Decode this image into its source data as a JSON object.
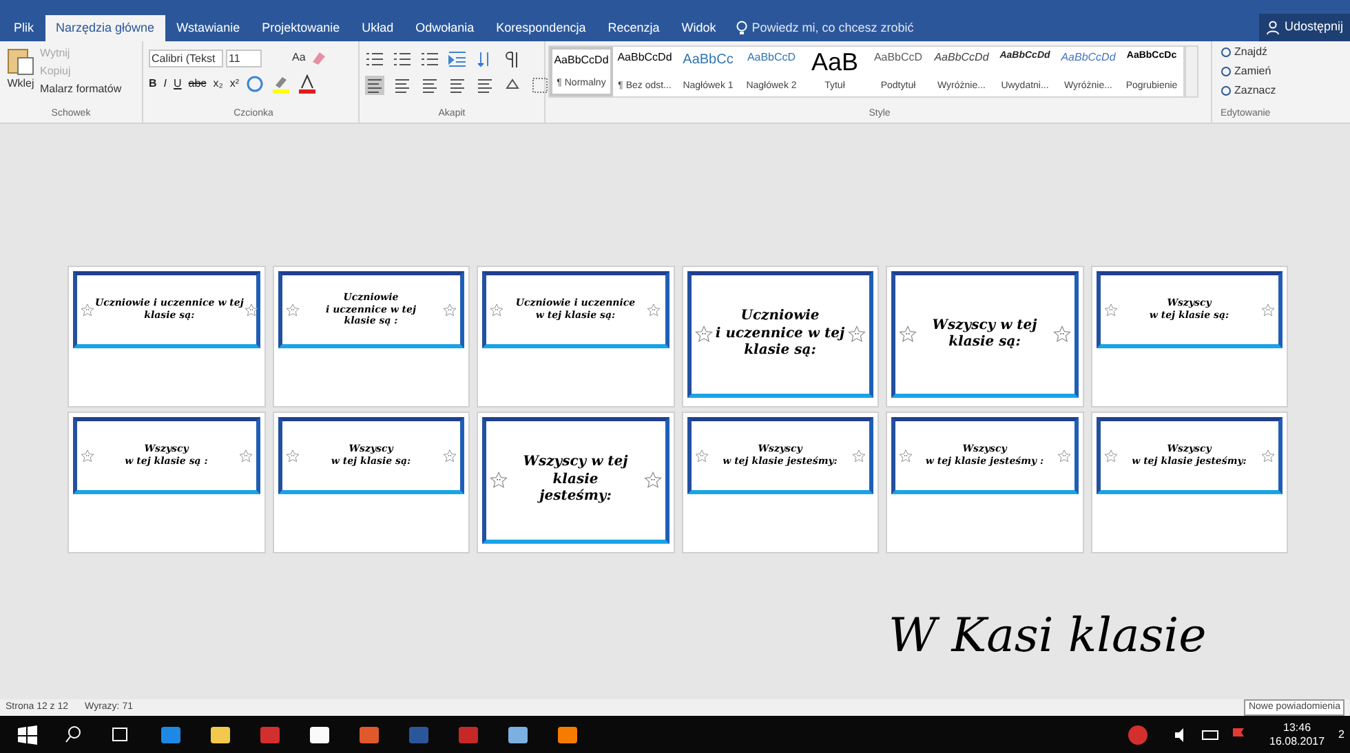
{
  "ribbon_tabs": [
    {
      "label": "Plik",
      "selected": false
    },
    {
      "label": "Narzędzia główne",
      "selected": true
    },
    {
      "label": "Wstawianie",
      "selected": false
    },
    {
      "label": "Projektowanie",
      "selected": false
    },
    {
      "label": "Układ",
      "selected": false
    },
    {
      "label": "Odwołania",
      "selected": false
    },
    {
      "label": "Korespondencja",
      "selected": false
    },
    {
      "label": "Recenzja",
      "selected": false
    },
    {
      "label": "Widok",
      "selected": false
    }
  ],
  "tell_me": {
    "placeholder": "Powiedz mi, co chcesz zrobić"
  },
  "share_button": "Udostępnij",
  "clipboard": {
    "paste": "Wklej",
    "items": [
      {
        "label": "Wytnij",
        "disabled": true
      },
      {
        "label": "Kopiuj",
        "disabled": true
      },
      {
        "label": "Malarz formatów",
        "disabled": false
      }
    ],
    "group": "Schowek"
  },
  "font": {
    "name": "Calibri (Tekst",
    "size": "11",
    "case": "Aa",
    "format_buttons": [
      "B",
      "I",
      "U",
      "abc",
      "x₂",
      "x²"
    ],
    "group": "Czcionka"
  },
  "paragraph": {
    "group": "Akapit"
  },
  "styles": {
    "group": "Style",
    "items": [
      {
        "preview": "AaBbCcDd",
        "name": "¶ Normalny",
        "kind": "normal",
        "selected": true
      },
      {
        "preview": "AaBbCcDd",
        "name": "¶ Bez odst...",
        "kind": "normal",
        "selected": false
      },
      {
        "preview": "AaBbCc",
        "name": "Nagłówek 1",
        "kind": "heading1",
        "selected": false
      },
      {
        "preview": "AaBbCcD",
        "name": "Nagłówek 2",
        "kind": "heading2",
        "selected": false
      },
      {
        "preview": "AaB",
        "name": "Tytuł",
        "kind": "title",
        "selected": false
      },
      {
        "preview": "AaBbCcD",
        "name": "Podtytuł",
        "kind": "subtitle",
        "selected": false
      },
      {
        "preview": "AaBbCcDd",
        "name": "Wyróżnie...",
        "kind": "emphasis",
        "selected": false
      },
      {
        "preview": "AaBbCcDd",
        "name": "Uwydatni...",
        "kind": "intense",
        "selected": false
      },
      {
        "preview": "AaBbCcDd",
        "name": "Wyróżnie...",
        "kind": "blue",
        "selected": false
      },
      {
        "preview": "AaBbCcDc",
        "name": "Pogrubienie",
        "kind": "strong",
        "selected": false
      }
    ]
  },
  "editing": {
    "group": "Edytowanie",
    "items": [
      "Znajdź",
      "Zamień",
      "Zaznacz"
    ]
  },
  "pages": [
    {
      "lines": [
        "Uczniowie i uczennice w tej",
        "klasie są:"
      ],
      "kind": "small"
    },
    {
      "lines": [
        "Uczniowie",
        "i uczennice w tej",
        "klasie są :"
      ],
      "kind": "small"
    },
    {
      "lines": [
        "Uczniowie i uczennice",
        "w tej klasie są:"
      ],
      "kind": "small"
    },
    {
      "lines": [
        "Uczniowie",
        "i uczennice w tej",
        "klasie są:"
      ],
      "kind": "large"
    },
    {
      "lines": [
        "Wszyscy w tej",
        "klasie są:"
      ],
      "kind": "large"
    },
    {
      "lines": [
        "Wszyscy",
        "w tej klasie są:"
      ],
      "kind": "small"
    },
    {
      "lines": [
        "Wszyscy",
        "w tej klasie są :"
      ],
      "kind": "small"
    },
    {
      "lines": [
        "Wszyscy",
        "w tej klasie są:"
      ],
      "kind": "small"
    },
    {
      "lines": [
        "Wszyscy w tej",
        "klasie",
        "jesteśmy:"
      ],
      "kind": "large"
    },
    {
      "lines": [
        "Wszyscy",
        "w tej klasie jesteśmy:"
      ],
      "kind": "small"
    },
    {
      "lines": [
        "Wszyscy",
        "w tej klasie jesteśmy :"
      ],
      "kind": "small"
    },
    {
      "lines": [
        "Wszyscy",
        "w tej klasie jesteśmy:"
      ],
      "kind": "small"
    }
  ],
  "handwriting": "W Kasi klasie",
  "status_bar": {
    "page": "Strona 12 z 12",
    "words": "Wyrazy: 71",
    "notification": "Nowe powiadomienia"
  },
  "taskbar": {
    "time": "13:46",
    "date": "16.08.2017",
    "notifications": "2"
  }
}
